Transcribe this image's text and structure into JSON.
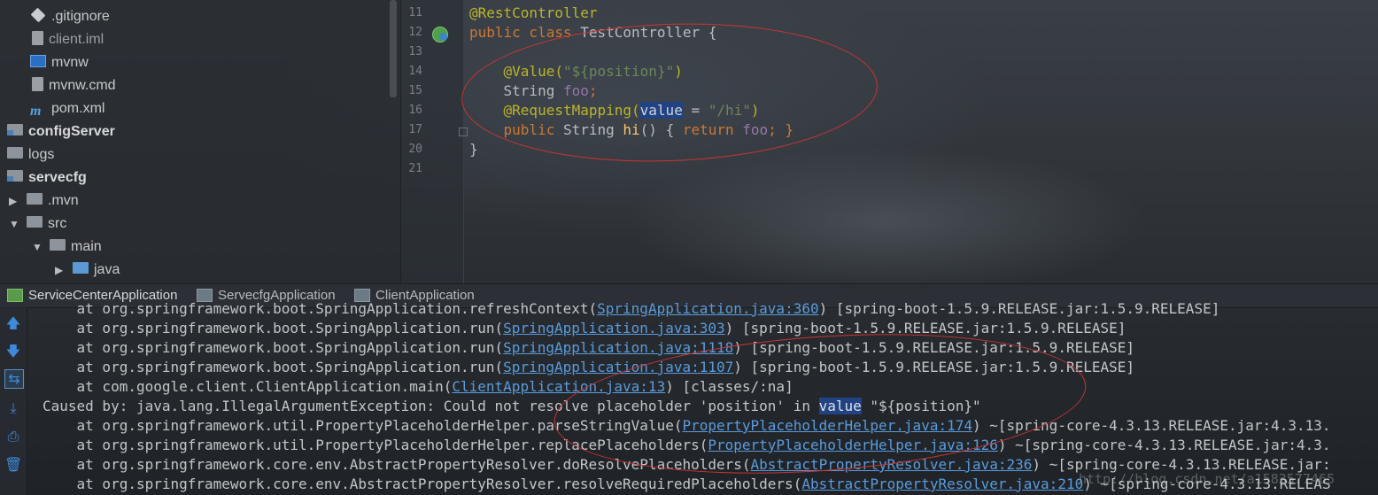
{
  "project_tree": {
    "items": [
      {
        "label": ".gitignore",
        "icon": "git-file-icon"
      },
      {
        "label": "client.iml",
        "icon": "iml-file-icon"
      },
      {
        "label": "mvnw",
        "icon": "terminal-file-icon"
      },
      {
        "label": "mvnw.cmd",
        "icon": "cmd-file-icon"
      },
      {
        "label": "pom.xml",
        "icon": "maven-icon"
      },
      {
        "label": "configServer",
        "icon": "module-folder-icon"
      },
      {
        "label": "logs",
        "icon": "folder-icon"
      },
      {
        "label": "servecfg",
        "icon": "module-folder-icon"
      },
      {
        "label": ".mvn",
        "icon": "folder-icon"
      },
      {
        "label": "src",
        "icon": "folder-icon"
      },
      {
        "label": "main",
        "icon": "folder-icon"
      },
      {
        "label": "java",
        "icon": "source-folder-icon"
      }
    ]
  },
  "editor": {
    "line_numbers": [
      "11",
      "12",
      "13",
      "14",
      "15",
      "16",
      "17",
      "20",
      "21"
    ],
    "lines": {
      "l11_ann": "@RestController",
      "l12_kw": "public class ",
      "l12_name": "TestController {",
      "l14_ann": "@Value(",
      "l14_str": "\"${position}\"",
      "l14_end": ")",
      "l15_type": "String ",
      "l15_field": "foo",
      "l15_end": ";",
      "l16_ann": "@RequestMapping(",
      "l16_attr": "value",
      "l16_eq": " = ",
      "l16_str": "\"/hi\"",
      "l16_end": ")",
      "l17_kw": "public ",
      "l17_type": "String ",
      "l17_fn": "hi",
      "l17_mid": "() { ",
      "l17_ret": "return ",
      "l17_field": "foo",
      "l17_end": "; }",
      "l20": "}"
    }
  },
  "run_tabs": [
    {
      "label": "ServiceCenterApplication"
    },
    {
      "label": "ServecfgApplication"
    },
    {
      "label": "ClientApplication"
    }
  ],
  "console": {
    "l1_pre": "    at org.springframework.boot.SpringApplication.refreshContext(",
    "l1_link": "SpringApplication.java:360",
    "l1_post": ") [spring-boot-1.5.9.RELEASE.jar:1.5.9.RELEASE]",
    "l2_pre": "    at org.springframework.boot.SpringApplication.run(",
    "l2_link": "SpringApplication.java:303",
    "l2_post": ") [spring-boot-1.5.9.RELEASE.jar:1.5.9.RELEASE]",
    "l3_pre": "    at org.springframework.boot.SpringApplication.run(",
    "l3_link": "SpringApplication.java:1118",
    "l3_post": ") [spring-boot-1.5.9.RELEASE.jar:1.5.9.RELEASE]",
    "l4_pre": "    at org.springframework.boot.SpringApplication.run(",
    "l4_link": "SpringApplication.java:1107",
    "l4_post": ") [spring-boot-1.5.9.RELEASE.jar:1.5.9.RELEASE]",
    "l5_pre": "    at com.google.client.ClientApplication.main(",
    "l5_link": "ClientApplication.java:13",
    "l5_post": ") [classes/:na]",
    "l6_pre": "Caused by: java.lang.IllegalArgumentException: Could not resolve placeholder 'position' in ",
    "l6_hl": "value",
    "l6_post": " \"${position}\"",
    "l7_pre": "    at org.springframework.util.PropertyPlaceholderHelper.parseStringValue(",
    "l7_link": "PropertyPlaceholderHelper.java:174",
    "l7_post": ") ~[spring-core-4.3.13.RELEASE.jar:4.3.13.",
    "l8_pre": "    at org.springframework.util.PropertyPlaceholderHelper.replacePlaceholders(",
    "l8_link": "PropertyPlaceholderHelper.java:126",
    "l8_post": ") ~[spring-core-4.3.13.RELEASE.jar:4.3.",
    "l9_pre": "    at org.springframework.core.env.AbstractPropertyResolver.doResolvePlaceholders(",
    "l9_link": "AbstractPropertyResolver.java:236",
    "l9_post": ") ~[spring-core-4.3.13.RELEASE.jar:",
    "l10_pre": "    at org.springframework.core.env.AbstractPropertyResolver.resolveRequiredPlaceholders(",
    "l10_link": "AbstractPropertyResolver.java:210",
    "l10_post": ") ~[spring-core-4.3.13.RELEAS"
  },
  "watermark": "http://blog.csdn.net/a1583577465",
  "colors": {
    "annotation": "#bbb529",
    "keyword": "#cc7832",
    "string": "#6a8759",
    "field": "#9876aa",
    "method": "#ffc66d",
    "link": "#5a9bdc",
    "highlight": "#214283",
    "circle": "#cc3333"
  }
}
